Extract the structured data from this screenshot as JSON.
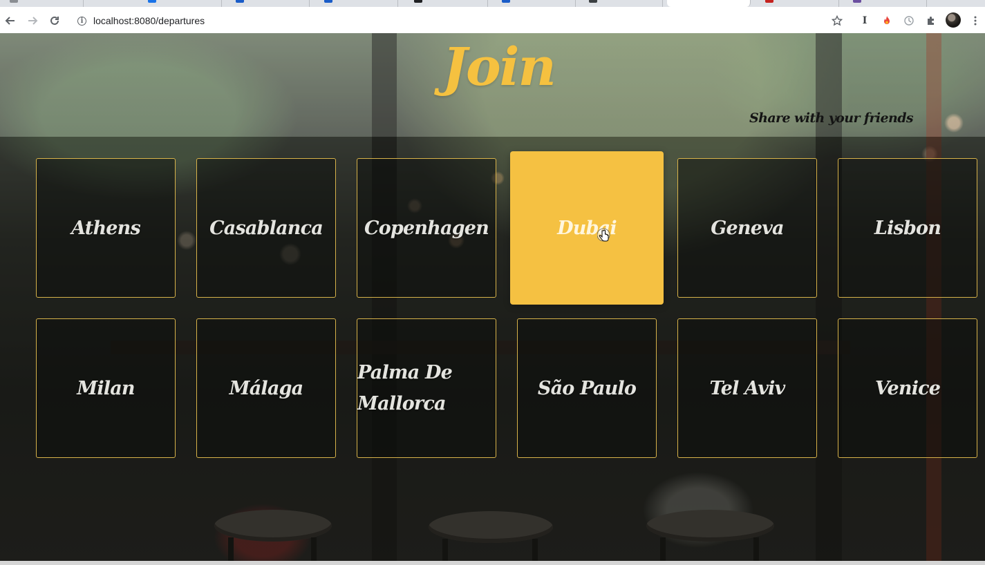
{
  "browser": {
    "url": "localhost:8080/departures",
    "tabs": [
      {
        "favicon_color": "#8a8e93"
      },
      {
        "favicon_color": "#1a73e8"
      },
      {
        "favicon_color": "#1a5cc8"
      },
      {
        "favicon_color": "#1a5cc8"
      },
      {
        "favicon_color": "#202124"
      },
      {
        "favicon_color": "#1a5cc8"
      },
      {
        "favicon_color": "#3c4043"
      },
      {
        "favicon_color": "#ffffff",
        "active": true
      },
      {
        "favicon_color": "#c5221f"
      },
      {
        "favicon_color": "#6b4fa0"
      }
    ],
    "icons": {
      "back": "arrow-left-icon",
      "forward": "arrow-right-icon",
      "reload": "reload-icon",
      "site_info": "info-icon",
      "bookmark": "star-icon",
      "extension_1": "text-cursor-icon",
      "extension_2": "fire-icon",
      "extension_3": "clock-icon",
      "extensions": "puzzle-icon",
      "menu": "vertical-dots-icon"
    }
  },
  "header": {
    "logo": "Join",
    "share": "Share with your friends"
  },
  "colors": {
    "accent": "#f5c142",
    "card_border": "#d8b34a",
    "card_text": "#e4e4df"
  },
  "departures": [
    {
      "city": "Athens"
    },
    {
      "city": "Casablanca"
    },
    {
      "city": "Copenhagen"
    },
    {
      "city": "Dubai",
      "state": "hover"
    },
    {
      "city": "Geneva"
    },
    {
      "city": "Lisbon"
    },
    {
      "city": "Milan"
    },
    {
      "city": "Málaga"
    },
    {
      "city": "Palma De Mallorca"
    },
    {
      "city": "São Paulo"
    },
    {
      "city": "Tel Aviv"
    },
    {
      "city": "Venice"
    }
  ]
}
